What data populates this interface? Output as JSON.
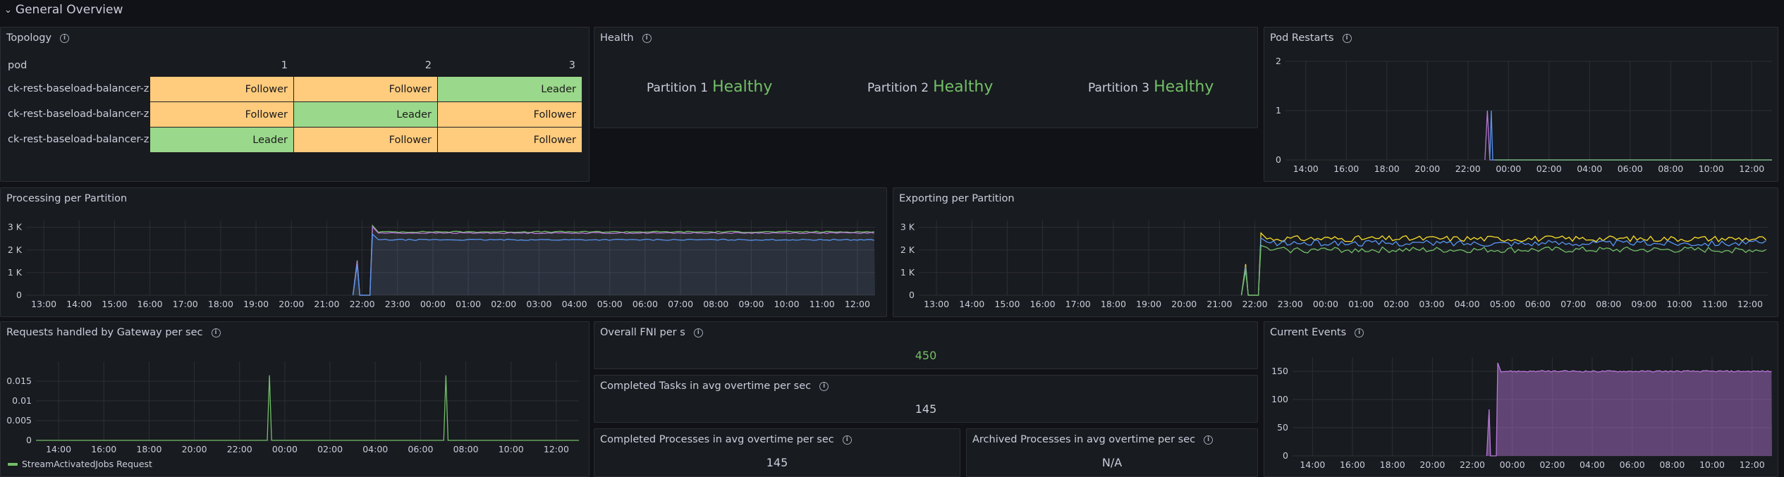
{
  "row": {
    "chevron": "⌄",
    "title": "General Overview"
  },
  "panels": {
    "topology": {
      "title": "Topology",
      "columns": [
        "pod",
        "1",
        "2",
        "3"
      ],
      "rows": [
        {
          "pod": "ck-rest-baseload-balancer-ze",
          "p1": "Follower",
          "p2": "Follower",
          "p3": "Leader"
        },
        {
          "pod": "ck-rest-baseload-balancer-ze",
          "p1": "Follower",
          "p2": "Leader",
          "p3": "Follower"
        },
        {
          "pod": "ck-rest-baseload-balancer-ze",
          "p1": "Leader",
          "p2": "Follower",
          "p3": "Follower"
        }
      ]
    },
    "health": {
      "title": "Health",
      "items": [
        {
          "label": "Partition 1",
          "value": "Healthy"
        },
        {
          "label": "Partition 2",
          "value": "Healthy"
        },
        {
          "label": "Partition 3",
          "value": "Healthy"
        }
      ]
    },
    "pod_restarts": {
      "title": "Pod Restarts"
    },
    "processing": {
      "title": "Processing per Partition"
    },
    "exporting": {
      "title": "Exporting per Partition"
    },
    "gateway": {
      "title": "Requests handled by Gateway per sec",
      "legend": "StreamActivatedJobs Request"
    },
    "fni": {
      "title": "Overall FNI per s",
      "value": "450"
    },
    "tasks": {
      "title": "Completed Tasks in avg overtime per sec",
      "value": "145"
    },
    "processes": {
      "title": "Completed Processes in avg overtime per sec",
      "value": "145"
    },
    "archived": {
      "title": "Archived Processes in avg overtime per sec",
      "value": "N/A"
    },
    "events": {
      "title": "Current Events"
    }
  },
  "colors": {
    "leader": "#9ad88b",
    "follower": "#ffcb7d",
    "healthy": "#73bf69",
    "green": "#73bf69",
    "blue": "#5794f2",
    "yellow": "#fade2a",
    "purple": "#b877d9",
    "panel_bg": "#181b1f"
  },
  "chart_data": [
    {
      "id": "pod_restarts",
      "type": "line",
      "x_ticks": [
        "14:00",
        "16:00",
        "18:00",
        "20:00",
        "22:00",
        "00:00",
        "02:00",
        "04:00",
        "06:00",
        "08:00",
        "10:00",
        "12:00"
      ],
      "y_ticks": [
        "0",
        "1",
        "2"
      ],
      "ylim": [
        0,
        2
      ],
      "series": [
        {
          "color": "#b877d9",
          "points": [
            [
              0.41,
              0
            ],
            [
              0.415,
              1
            ],
            [
              0.42,
              0
            ],
            [
              1,
              0
            ]
          ]
        },
        {
          "color": "#5794f2",
          "points": [
            [
              0.42,
              0
            ],
            [
              0.423,
              1
            ],
            [
              0.426,
              0
            ],
            [
              1,
              0
            ]
          ]
        },
        {
          "color": "#73bf69",
          "points": [
            [
              0.43,
              0
            ],
            [
              1,
              0
            ]
          ]
        }
      ]
    },
    {
      "id": "processing",
      "type": "area",
      "x_ticks": [
        "13:00",
        "14:00",
        "15:00",
        "16:00",
        "17:00",
        "18:00",
        "19:00",
        "20:00",
        "21:00",
        "22:00",
        "23:00",
        "00:00",
        "01:00",
        "02:00",
        "03:00",
        "04:00",
        "05:00",
        "06:00",
        "07:00",
        "08:00",
        "09:00",
        "10:00",
        "11:00",
        "12:00"
      ],
      "y_ticks": [
        "0",
        "1 K",
        "2 K",
        "3 K"
      ],
      "ylim": [
        0,
        3300
      ],
      "series": [
        {
          "color": "#73bf69",
          "start": 0.405,
          "level": 2800
        },
        {
          "color": "#b877d9",
          "start": 0.405,
          "level": 2750
        },
        {
          "color": "#5794f2",
          "start": 0.405,
          "level": 2450
        }
      ]
    },
    {
      "id": "exporting",
      "type": "line",
      "x_ticks": [
        "13:00",
        "14:00",
        "15:00",
        "16:00",
        "17:00",
        "18:00",
        "19:00",
        "20:00",
        "21:00",
        "22:00",
        "23:00",
        "00:00",
        "01:00",
        "02:00",
        "03:00",
        "04:00",
        "05:00",
        "06:00",
        "07:00",
        "08:00",
        "09:00",
        "10:00",
        "11:00",
        "12:00"
      ],
      "y_ticks": [
        "0",
        "1 K",
        "2 K",
        "3 K"
      ],
      "ylim": [
        0,
        3300
      ],
      "series": [
        {
          "color": "#fade2a",
          "start": 0.4,
          "level": 2500
        },
        {
          "color": "#5794f2",
          "start": 0.4,
          "level": 2300
        },
        {
          "color": "#73bf69",
          "start": 0.4,
          "level": 2000
        }
      ]
    },
    {
      "id": "gateway",
      "type": "line",
      "x_ticks": [
        "14:00",
        "16:00",
        "18:00",
        "20:00",
        "22:00",
        "00:00",
        "02:00",
        "04:00",
        "06:00",
        "08:00",
        "10:00",
        "12:00"
      ],
      "y_ticks": [
        "0",
        "0.005",
        "0.01",
        "0.015"
      ],
      "ylim": [
        0,
        0.02
      ],
      "series": [
        {
          "name": "StreamActivatedJobs Request",
          "color": "#73bf69",
          "spikes": [
            [
              0.43,
              0.0165
            ],
            [
              0.755,
              0.0165
            ]
          ]
        }
      ]
    },
    {
      "id": "events",
      "type": "area",
      "x_ticks": [
        "14:00",
        "16:00",
        "18:00",
        "20:00",
        "22:00",
        "00:00",
        "02:00",
        "04:00",
        "06:00",
        "08:00",
        "10:00",
        "12:00"
      ],
      "y_ticks": [
        "0",
        "50",
        "100",
        "150"
      ],
      "ylim": [
        0,
        175
      ],
      "series": [
        {
          "color": "#b877d9",
          "start": 0.425,
          "level": 150
        }
      ]
    }
  ]
}
